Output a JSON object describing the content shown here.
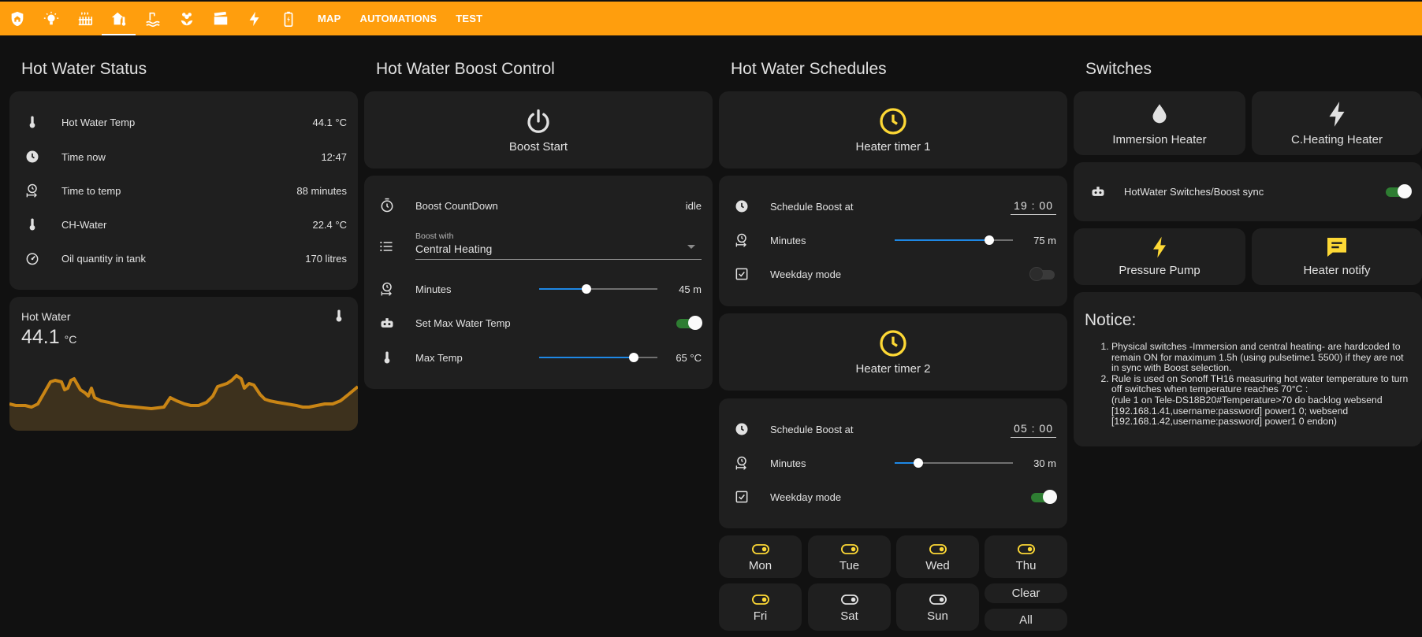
{
  "nav": {
    "icons": [
      "shield-home-icon",
      "lightbulb-icon",
      "radiator-icon",
      "home-thermometer-icon",
      "water-boiler-icon",
      "flower-icon",
      "movie-icon",
      "lightning-icon",
      "battery-icon"
    ],
    "active_index": 3,
    "text_tabs": [
      "MAP",
      "AUTOMATIONS",
      "TEST"
    ]
  },
  "columns": {
    "status_title": "Hot Water Status",
    "boost_title": "Hot Water Boost Control",
    "schedules_title": "Hot Water Schedules",
    "switches_title": "Switches"
  },
  "status": {
    "rows": [
      {
        "icon": "thermometer-icon",
        "label": "Hot Water Temp",
        "value": "44.1 °C"
      },
      {
        "icon": "clock-icon",
        "label": "Time now",
        "value": "12:47"
      },
      {
        "icon": "timer-arrow-icon",
        "label": "Time to temp",
        "value": "88 minutes"
      },
      {
        "icon": "thermometer-icon",
        "label": "CH-Water",
        "value": "22.4 °C"
      },
      {
        "icon": "gauge-icon",
        "label": "Oil quantity in tank",
        "value": "170 litres"
      }
    ]
  },
  "sensor": {
    "title": "Hot Water",
    "value": "44.1",
    "unit": "°C",
    "line_color": "#c98515"
  },
  "boost": {
    "start_label": "Boost Start",
    "countdown_label": "Boost CountDown",
    "countdown_value": "idle",
    "boost_with_caption": "Boost with",
    "boost_with_value": "Central Heating",
    "minutes_label": "Minutes",
    "minutes_value": "45 m",
    "minutes_fraction": 0.4,
    "set_max_label": "Set Max Water Temp",
    "set_max_on": true,
    "max_temp_label": "Max Temp",
    "max_temp_value": "65 °C",
    "max_temp_fraction": 0.8
  },
  "schedules": {
    "timer1": {
      "label": "Heater timer 1",
      "schedule_label": "Schedule Boost at",
      "time": "19 : 00",
      "minutes_label": "Minutes",
      "minutes_value": "75 m",
      "minutes_fraction": 0.8,
      "weekday_label": "Weekday mode",
      "weekday_on": false
    },
    "timer2": {
      "label": "Heater timer 2",
      "schedule_label": "Schedule Boost at",
      "time": "05 : 00",
      "minutes_label": "Minutes",
      "minutes_value": "30 m",
      "minutes_fraction": 0.2,
      "weekday_label": "Weekday mode",
      "weekday_on": true
    },
    "days": [
      {
        "label": "Mon",
        "active": true
      },
      {
        "label": "Tue",
        "active": true
      },
      {
        "label": "Wed",
        "active": true
      },
      {
        "label": "Thu",
        "active": true
      },
      {
        "label": "Fri",
        "active": true
      },
      {
        "label": "Sat",
        "active": false
      },
      {
        "label": "Sun",
        "active": false
      }
    ],
    "clear_label": "Clear",
    "all_label": "All"
  },
  "switches": {
    "immersion_label": "Immersion Heater",
    "cheating_label": "C.Heating Heater",
    "sync_label": "HotWater Switches/Boost sync",
    "sync_on": true,
    "pump_label": "Pressure Pump",
    "notify_label": "Heater notify"
  },
  "notice": {
    "title": "Notice:",
    "items": [
      "Physical switches -Immersion and central heating- are hardcoded to remain ON for maximum 1.5h (using pulsetime1 5500) if they are not in sync with Boost selection.",
      "Rule is used on Sonoff TH16 measuring hot water temperature to turn off switches when temperature reaches 70°C :"
    ],
    "rule_text": "(rule 1 on Tele-DS18B20#Temperature>70 do backlog websend [192.168.1.41,username:password] power1 0; websend [192.168.1.42,username:password] power1 0 endon)"
  },
  "colors": {
    "accent": "#ff9e0d",
    "card": "#1f1f1f",
    "background": "#111111",
    "yellow_icon": "#fdd835",
    "slider": "#1e88e5",
    "toggle_on": "#2e7d32"
  }
}
